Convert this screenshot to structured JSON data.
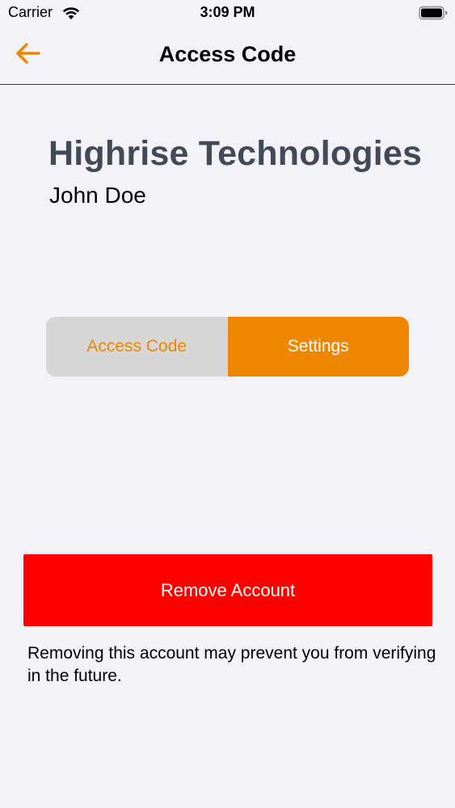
{
  "status_bar": {
    "carrier": "Carrier",
    "time": "3:09 PM",
    "wifi_icon": "wifi-icon",
    "battery_icon": "battery-icon"
  },
  "nav": {
    "title": "Access Code",
    "back_icon": "arrow-left-icon"
  },
  "account": {
    "company": "Highrise Technologies",
    "user": "John Doe"
  },
  "segments": {
    "access_code": "Access Code",
    "settings": "Settings",
    "selected": "Settings"
  },
  "remove": {
    "button_label": "Remove Account",
    "warning": "Removing this account may prevent you from verifying in the future."
  },
  "colors": {
    "accent": "#ef8600",
    "danger": "#ff0000",
    "company_text": "#424a57",
    "background": "#f2f2f7",
    "segment_inactive": "#d6d6d6"
  }
}
